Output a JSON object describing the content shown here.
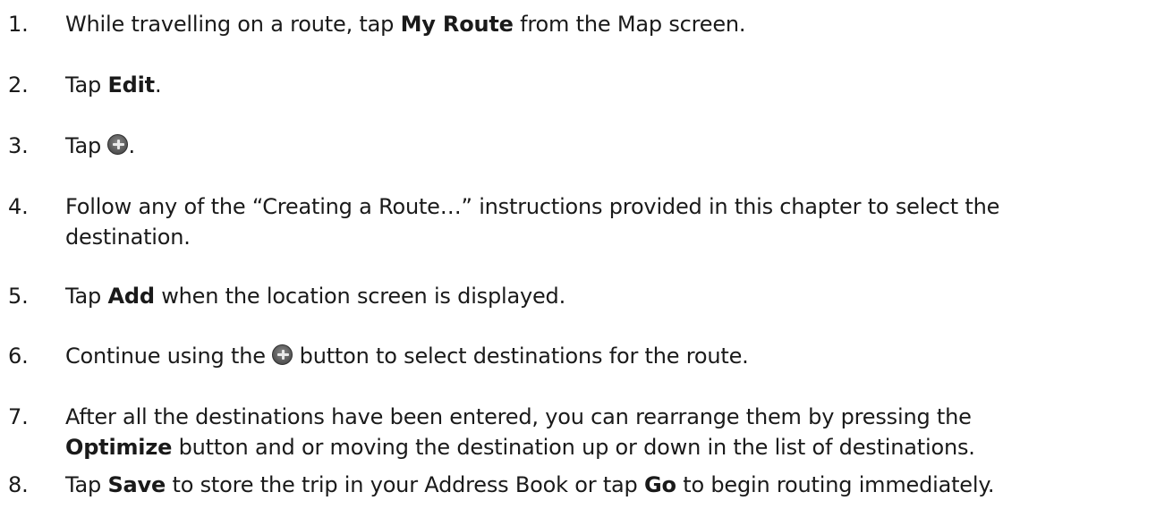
{
  "steps": [
    {
      "number": "1.",
      "parts": {
        "a": "While travelling on a route, tap ",
        "b": "My Route",
        "c": " from the Map screen."
      }
    },
    {
      "number": "2.",
      "parts": {
        "a": "Tap ",
        "b": "Edit",
        "c": "."
      }
    },
    {
      "number": "3.",
      "parts": {
        "a": "Tap ",
        "c": "."
      },
      "icon": "plus-circle-icon"
    },
    {
      "number": "4.",
      "lines": [
        "Follow any of the “Creating a Route…” instructions provided in this chapter to select the",
        "destination."
      ]
    },
    {
      "number": "5.",
      "parts": {
        "a": "Tap ",
        "b": "Add",
        "c": " when the location screen is displayed."
      }
    },
    {
      "number": "6.",
      "parts": {
        "a": "Continue using the ",
        "c": " button to select destinations for the route."
      },
      "icon": "plus-circle-icon"
    },
    {
      "number": "7.",
      "line1": "After all the destinations have been entered, you can rearrange them by pressing the",
      "line2": {
        "b": "Optimize",
        "c": " button and or moving the destination up or down in the list of destinations."
      }
    },
    {
      "number": "8.",
      "parts": {
        "a": "Tap ",
        "b": "Save",
        "c": " to store the trip in your Address Book or tap ",
        "d": "Go",
        "e": " to begin routing immediately."
      }
    }
  ]
}
